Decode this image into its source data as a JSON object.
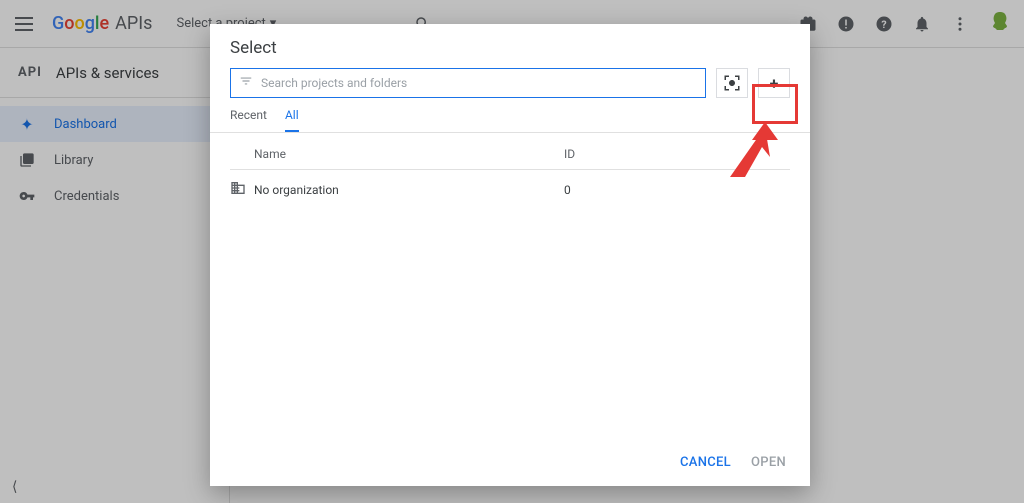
{
  "header": {
    "logo_apis": "APIs",
    "project_selector": "Select a project"
  },
  "sidebar": {
    "badge": "API",
    "title": "APIs & services",
    "items": [
      {
        "label": "Dashboard"
      },
      {
        "label": "Library"
      },
      {
        "label": "Credentials"
      }
    ]
  },
  "dialog": {
    "title": "Select",
    "search_placeholder": "Search projects and folders",
    "tabs": [
      {
        "label": "Recent"
      },
      {
        "label": "All"
      }
    ],
    "columns": {
      "name": "Name",
      "id": "ID"
    },
    "rows": [
      {
        "name": "No organization",
        "id": "0"
      }
    ],
    "cancel": "CANCEL",
    "open": "OPEN"
  }
}
